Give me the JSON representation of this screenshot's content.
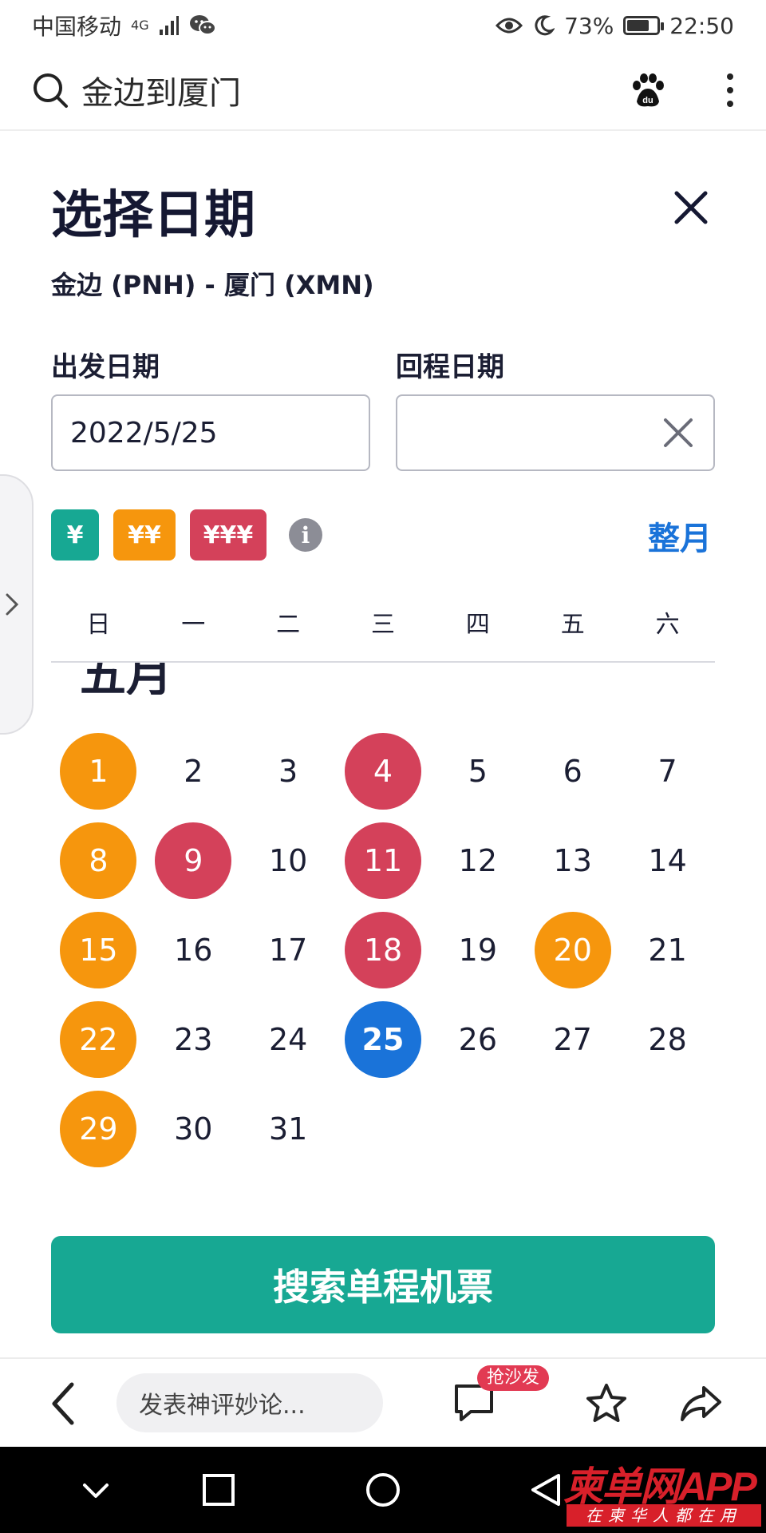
{
  "status_bar": {
    "carrier": "中国移动",
    "network": "4G",
    "battery_percent_label": "73%",
    "battery_level": 0.73,
    "time": "22:50"
  },
  "browser": {
    "query": "金边到厦门"
  },
  "dialog": {
    "title": "选择日期",
    "route": "金边 (PNH) - 厦门 (XMN)",
    "depart_label": "出发日期",
    "return_label": "回程日期",
    "depart_value": "2022/5/25",
    "return_value": "",
    "price_tags": [
      {
        "label": "¥",
        "color": "#17a893"
      },
      {
        "label": "¥¥",
        "color": "#f6960d"
      },
      {
        "label": "¥¥¥",
        "color": "#d4415a"
      }
    ],
    "whole_month_label": "整月",
    "weekdays": [
      "日",
      "一",
      "二",
      "三",
      "四",
      "五",
      "六"
    ],
    "month_title": "五月",
    "search_button": "搜索单程机票"
  },
  "calendar": {
    "weeks": [
      [
        {
          "d": "1",
          "t": "orange"
        },
        {
          "d": "2",
          "t": ""
        },
        {
          "d": "3",
          "t": ""
        },
        {
          "d": "4",
          "t": "red"
        },
        {
          "d": "5",
          "t": ""
        },
        {
          "d": "6",
          "t": ""
        },
        {
          "d": "7",
          "t": ""
        }
      ],
      [
        {
          "d": "8",
          "t": "orange"
        },
        {
          "d": "9",
          "t": "red"
        },
        {
          "d": "10",
          "t": ""
        },
        {
          "d": "11",
          "t": "red"
        },
        {
          "d": "12",
          "t": ""
        },
        {
          "d": "13",
          "t": ""
        },
        {
          "d": "14",
          "t": ""
        }
      ],
      [
        {
          "d": "15",
          "t": "orange"
        },
        {
          "d": "16",
          "t": ""
        },
        {
          "d": "17",
          "t": ""
        },
        {
          "d": "18",
          "t": "red"
        },
        {
          "d": "19",
          "t": ""
        },
        {
          "d": "20",
          "t": "orange"
        },
        {
          "d": "21",
          "t": ""
        }
      ],
      [
        {
          "d": "22",
          "t": "orange"
        },
        {
          "d": "23",
          "t": ""
        },
        {
          "d": "24",
          "t": ""
        },
        {
          "d": "25",
          "t": "selected"
        },
        {
          "d": "26",
          "t": ""
        },
        {
          "d": "27",
          "t": ""
        },
        {
          "d": "28",
          "t": ""
        }
      ],
      [
        {
          "d": "29",
          "t": "orange"
        },
        {
          "d": "30",
          "t": ""
        },
        {
          "d": "31",
          "t": ""
        }
      ]
    ]
  },
  "comment_bar": {
    "placeholder": "发表神评妙论...",
    "badge": "抢沙发"
  },
  "watermark": {
    "brand": "柬单网APP",
    "tagline": "在柬华人都在用"
  },
  "colors": {
    "orange": "#f6960d",
    "red": "#d4415a",
    "teal": "#17a893",
    "blue": "#1a73d9"
  },
  "icons": [
    "search-icon",
    "baidu-paw-icon",
    "more-vertical-icon",
    "close-icon",
    "clear-icon",
    "info-icon",
    "chevron-right-icon",
    "back-icon",
    "comment-icon",
    "star-icon",
    "share-icon",
    "nav-down-icon",
    "nav-recents-icon",
    "nav-home-icon",
    "nav-back-icon"
  ]
}
